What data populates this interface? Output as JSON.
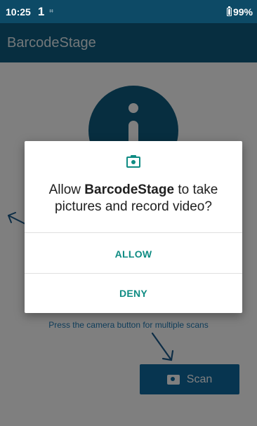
{
  "status_bar": {
    "time": "10:25",
    "notification": "1",
    "grid_glyph": "⌗",
    "battery": "99%"
  },
  "app_bar": {
    "title": "BarcodeStage"
  },
  "main": {
    "hint": "Press the camera button for multiple scans",
    "scan_label": "Scan"
  },
  "dialog": {
    "message_prefix": "Allow ",
    "app_name": "BarcodeStage",
    "message_suffix": " to take pictures and record video?",
    "allow_label": "ALLOW",
    "deny_label": "DENY"
  },
  "colors": {
    "status_bar": "#0d4a66",
    "app_bar": "#0f5c80",
    "dialog_accent": "#0f8c83",
    "scan_button": "#0f6aa0",
    "hint_text": "#1f7ab5"
  },
  "icons": [
    "battery-icon",
    "grid-icon",
    "info-icon",
    "camera-icon",
    "arrow-icon"
  ]
}
